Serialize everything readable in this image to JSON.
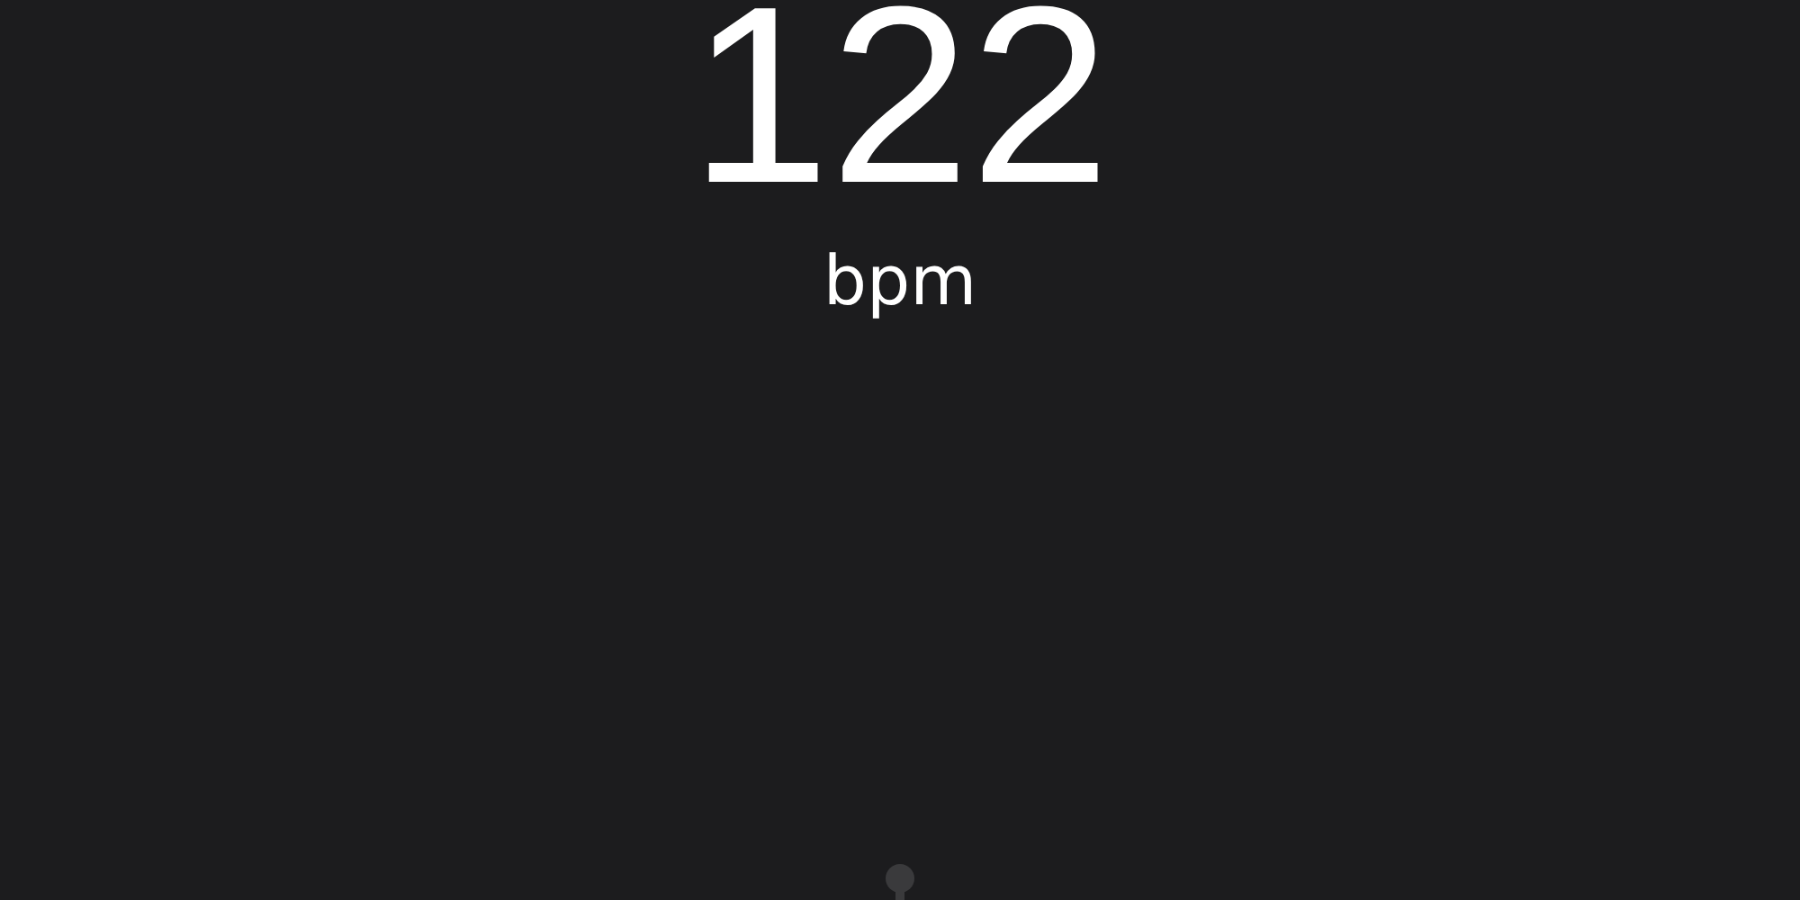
{
  "tempo": {
    "value": "122",
    "unit": "bpm"
  }
}
